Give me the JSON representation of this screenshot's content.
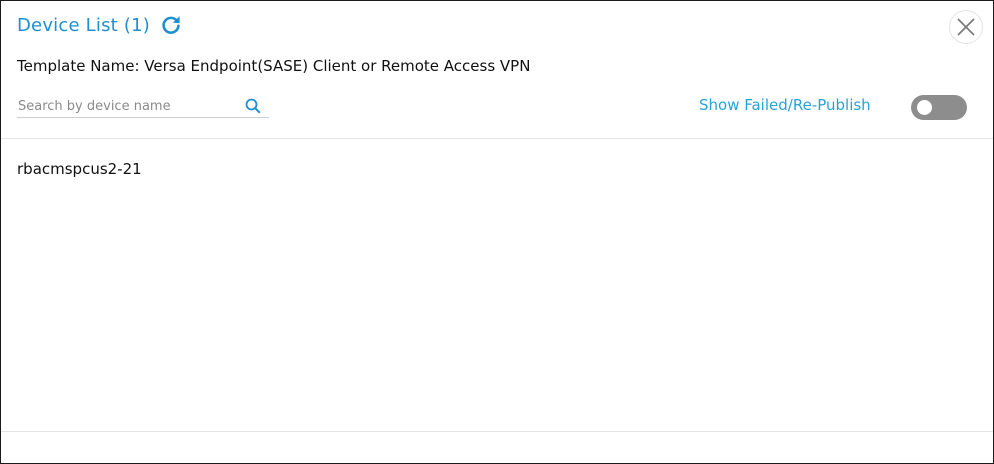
{
  "dialog": {
    "title": "Device List (1)",
    "template_label": "Template Name: Versa Endpoint(SASE) Client or Remote Access VPN",
    "icons": {
      "refresh": "refresh-icon",
      "close": "close-icon",
      "search": "search-icon"
    },
    "accent_color": "#1f8fd0"
  },
  "search": {
    "placeholder": "Search by device name",
    "value": ""
  },
  "toggle": {
    "label": "Show Failed/Re-Publish",
    "state": "off"
  },
  "devices": [
    {
      "name": "rbacmspcus2-21"
    }
  ]
}
